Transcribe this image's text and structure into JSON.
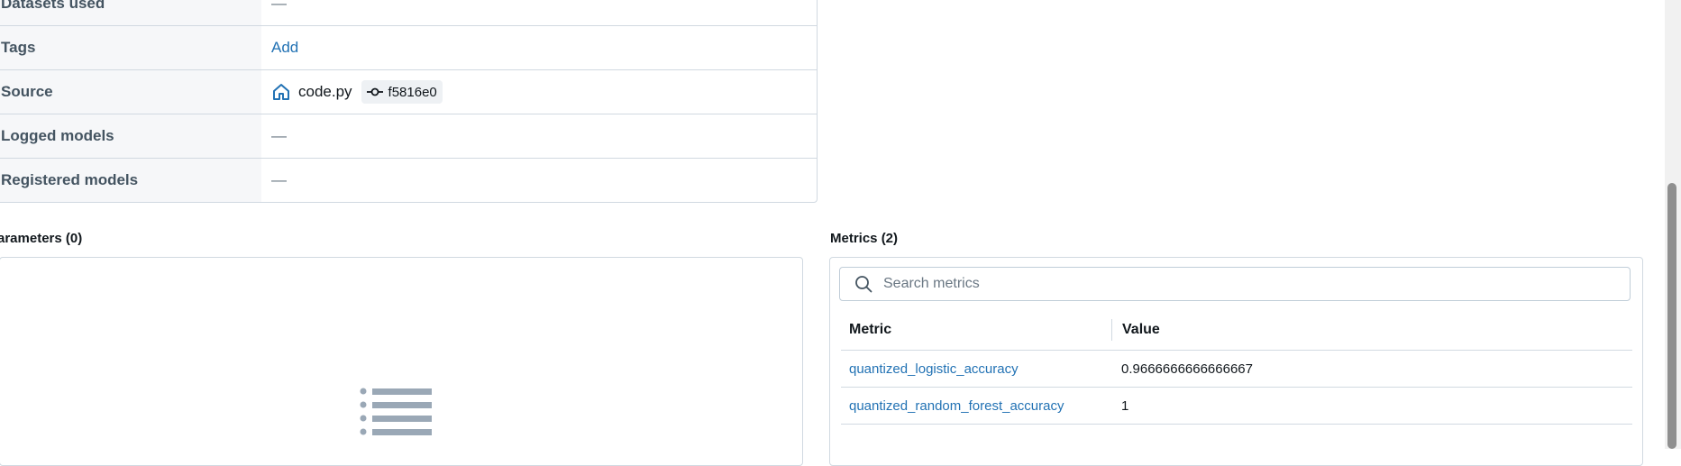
{
  "details": {
    "rows": [
      {
        "label": "Datasets used",
        "value": "—"
      },
      {
        "label": "Tags",
        "value": "Add"
      },
      {
        "label": "Source",
        "file": "code.py",
        "commit": "f5816e0"
      },
      {
        "label": "Logged models",
        "value": "—"
      },
      {
        "label": "Registered models",
        "value": "—"
      }
    ]
  },
  "parameters": {
    "title": "arameters (0)"
  },
  "metrics": {
    "title": "Metrics (2)",
    "search_placeholder": "Search metrics",
    "columns": [
      "Metric",
      "Value"
    ],
    "rows": [
      {
        "metric": "quantized_logistic_accuracy",
        "value": "0.9666666666666667"
      },
      {
        "metric": "quantized_random_forest_accuracy",
        "value": "1"
      }
    ]
  },
  "colors": {
    "link": "#2272b4",
    "border": "#d1d9e1",
    "label_bg": "#f6f7f9",
    "empty_icon": "#9aa8b6"
  }
}
